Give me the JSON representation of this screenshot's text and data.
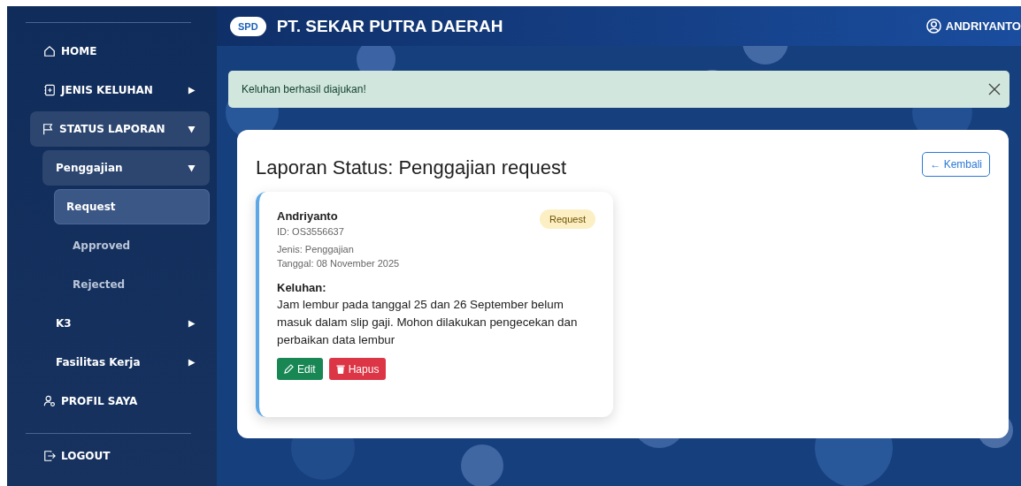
{
  "sidebar": {
    "items": [
      {
        "label": "HOME",
        "selected": false
      },
      {
        "label": "JENIS KELUHAN",
        "selected": false,
        "expanded": false
      },
      {
        "label": "STATUS LAPORAN",
        "selected": false,
        "expanded": true,
        "children": [
          {
            "label": "Penggajian",
            "selected": false,
            "expanded": true,
            "children": [
              {
                "label": "Request",
                "selected": true
              },
              {
                "label": "Approved",
                "selected": false
              },
              {
                "label": "Rejected",
                "selected": false
              }
            ]
          },
          {
            "label": "K3",
            "selected": false,
            "expanded": false
          },
          {
            "label": "Fasilitas Kerja",
            "selected": false,
            "expanded": false
          }
        ]
      },
      {
        "label": "PROFIL SAYA",
        "selected": false
      }
    ],
    "logout": "LOGOUT"
  },
  "header": {
    "logo": "SPD",
    "company": "PT. SEKAR PUTRA DAERAH",
    "user": "ANDRIYANTO"
  },
  "alert": {
    "message": "Keluhan berhasil diajukan!"
  },
  "page": {
    "title": "Laporan Status: Penggajian request",
    "back_button": "← Kembali",
    "reports": [
      {
        "name": "Andriyanto",
        "id": "ID: OS3556637",
        "type": "Jenis: Penggajian",
        "date": "Tanggal: 08 November 2025",
        "status": "Request",
        "complaint_label": "Keluhan:",
        "complaint": "Jam lembur pada tanggal 25 dan 26 September belum masuk dalam slip gaji. Mohon dilakukan pengecekan dan perbaikan data lembur",
        "buttons": [
          {
            "label": "Edit",
            "kind": "edit"
          },
          {
            "label": "Hapus",
            "kind": "delete"
          }
        ]
      }
    ]
  }
}
